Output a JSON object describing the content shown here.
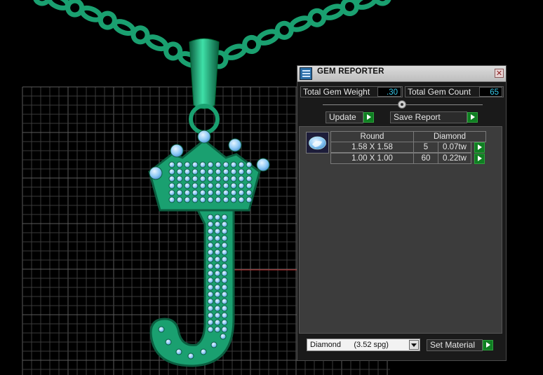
{
  "window": {
    "title": "GEM REPORTER",
    "close_glyph": "✕"
  },
  "totals": {
    "weight_label": "Total Gem Weight",
    "weight_value": ".30",
    "count_label": "Total Gem Count",
    "count_value": "65"
  },
  "buttons": {
    "update": "Update",
    "save_report": "Save Report",
    "set_material": "Set Material"
  },
  "gem_table": {
    "headers": [
      "Round",
      "Diamond"
    ],
    "rows": [
      {
        "size": "1.58 X 1.58",
        "count": "5",
        "weight": "0.07tw"
      },
      {
        "size": "1.00 X 1.00",
        "count": "60",
        "weight": "0.22tw"
      }
    ]
  },
  "material": {
    "selected": "Diamond      (3.52 spg)"
  },
  "colors": {
    "model_green": "#1aa070",
    "gem_blue": "#9fd2f7",
    "value_cyan": "#37c8e8",
    "arrow_green": "#0f7f22"
  },
  "icons": [
    "app-icon",
    "close-icon",
    "slider-knob-icon",
    "gem-shape-icon",
    "arrow-right-icon",
    "chevron-down-icon"
  ]
}
